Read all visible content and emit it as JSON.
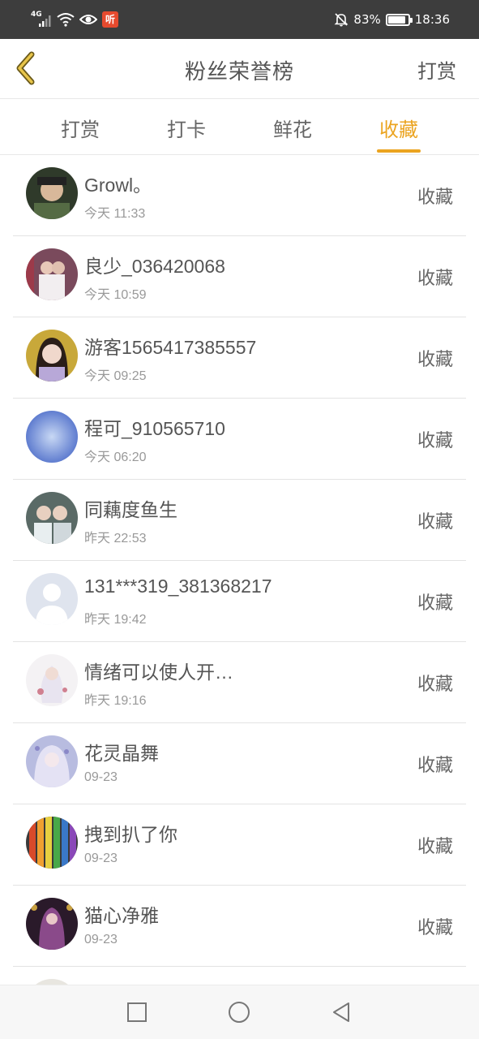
{
  "status_bar": {
    "network": "4G",
    "battery_percent": "83%",
    "time": "18:36",
    "app_badge": "听",
    "icons": [
      "signal-icon",
      "wifi-icon",
      "eye-icon",
      "app-badge-icon",
      "mute-icon",
      "battery-icon"
    ]
  },
  "header": {
    "title": "粉丝荣誉榜",
    "action_label": "打赏",
    "back_icon": "chevron-left-icon",
    "accent_color": "#eba420"
  },
  "tabs": [
    {
      "label": "打赏",
      "active": false
    },
    {
      "label": "打卡",
      "active": false
    },
    {
      "label": "鲜花",
      "active": false
    },
    {
      "label": "收藏",
      "active": true
    }
  ],
  "list": {
    "items": [
      {
        "name": "Growl。",
        "time": "今天  11:33",
        "action": "收藏"
      },
      {
        "name": "良少_036420068",
        "time": "今天  10:59",
        "action": "收藏"
      },
      {
        "name": "游客1565417385557",
        "time": "今天  09:25",
        "action": "收藏"
      },
      {
        "name": "程可_910565710",
        "time": "今天  06:20",
        "action": "收藏"
      },
      {
        "name": "同藕度鱼生",
        "time": "昨天  22:53",
        "action": "收藏"
      },
      {
        "name": "131***319_381368217",
        "time": "昨天  19:42",
        "action": "收藏"
      },
      {
        "name": "情绪可以使人开…",
        "time": "昨天  19:16",
        "action": "收藏"
      },
      {
        "name": "花灵晶舞",
        "time": "09-23",
        "action": "收藏"
      },
      {
        "name": "拽到扒了你",
        "time": "09-23",
        "action": "收藏"
      },
      {
        "name": "猫心净雅",
        "time": "09-23",
        "action": "收藏"
      }
    ]
  },
  "nav_bar": {
    "icons": [
      "square-recent-icon",
      "circle-home-icon",
      "triangle-back-icon"
    ]
  }
}
